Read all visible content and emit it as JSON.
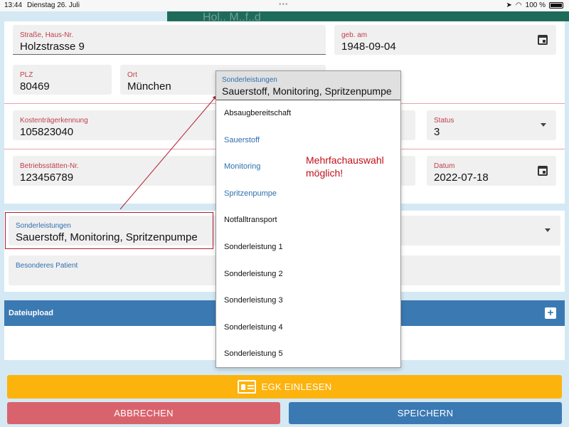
{
  "status_bar": {
    "time": "13:44",
    "date": "Dienstag 26. Juli",
    "battery": "100 %"
  },
  "header": {
    "title_partial": "Hol.. M..f..d"
  },
  "fields": {
    "street": {
      "label": "Straße, Haus-Nr.",
      "value": "Holzstrasse 9"
    },
    "birth": {
      "label": "geb. am",
      "value": "1948-09-04"
    },
    "plz": {
      "label": "PLZ",
      "value": "80469"
    },
    "ort": {
      "label": "Ort",
      "value": "München"
    },
    "kostentraeger": {
      "label": "Kostenträgerkennung",
      "value": "105823040"
    },
    "status": {
      "label": "Status",
      "value": "3"
    },
    "betriebsstaette": {
      "label": "Betriebsstätten-Nr.",
      "value": "123456789"
    },
    "datum": {
      "label": "Datum",
      "value": "2022-07-18"
    },
    "sonderleistungen": {
      "label": "Sonderleistungen",
      "value": "Sauerstoff, Monitoring, Spritzenpumpe"
    },
    "besonderes": {
      "label": "Besonderes Patient"
    }
  },
  "dropdown": {
    "label": "Sonderleistungen",
    "value": "Sauerstoff, Monitoring, Spritzenpumpe",
    "options": [
      {
        "label": "Absaugbereitschaft",
        "selected": false
      },
      {
        "label": "Sauerstoff",
        "selected": true
      },
      {
        "label": "Monitoring",
        "selected": true
      },
      {
        "label": "Spritzenpumpe",
        "selected": true
      },
      {
        "label": "Notfalltransport",
        "selected": false
      },
      {
        "label": "Sonderleistung 1",
        "selected": false
      },
      {
        "label": "Sonderleistung 2",
        "selected": false
      },
      {
        "label": "Sonderleistung 3",
        "selected": false
      },
      {
        "label": "Sonderleistung 4",
        "selected": false
      },
      {
        "label": "Sonderleistung 5",
        "selected": false
      }
    ]
  },
  "annotation": {
    "line1": "Mehrfachauswahl",
    "line2": "möglich!"
  },
  "upload": {
    "title": "Dateiupload"
  },
  "buttons": {
    "egk": "EGK EINLESEN",
    "cancel": "ABBRECHEN",
    "save": "SPEICHERN"
  },
  "colors": {
    "teal_header": "#1f6b5a",
    "label_red": "#c0404b",
    "accent_blue": "#3b79b3",
    "egk_orange": "#fdb30d",
    "cancel_red": "#d9636d",
    "annotation_red": "#c0101c"
  },
  "icons": {
    "calendar": "calendar-icon",
    "dropdown_arrow": "chevron-down-icon",
    "add": "plus-icon",
    "card": "id-card-icon"
  }
}
